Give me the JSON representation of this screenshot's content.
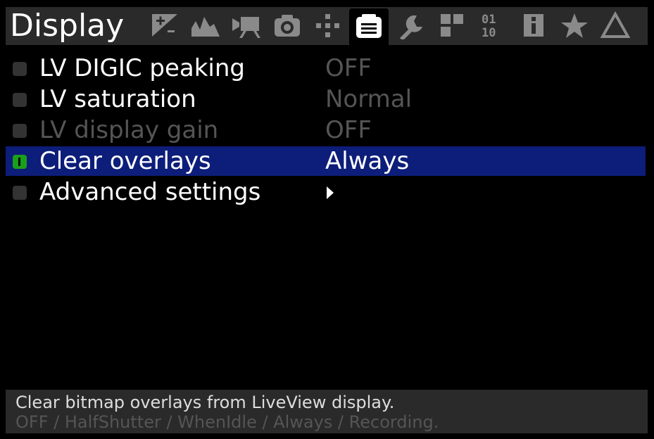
{
  "header": {
    "title": "Display",
    "tabs": [
      {
        "icon": "exposure-icon"
      },
      {
        "icon": "histogram-icon"
      },
      {
        "icon": "movie-camera-icon"
      },
      {
        "icon": "camera-icon"
      },
      {
        "icon": "focus-points-icon"
      },
      {
        "icon": "display-icon",
        "active": true
      },
      {
        "icon": "wrench-icon"
      },
      {
        "icon": "modules-icon"
      },
      {
        "icon": "binary-debug-icon"
      },
      {
        "icon": "info-icon"
      },
      {
        "icon": "star-icon"
      },
      {
        "icon": "triangle-icon"
      }
    ]
  },
  "menu": {
    "items": [
      {
        "label": "LV DIGIC peaking",
        "value": "OFF"
      },
      {
        "label": "LV saturation",
        "value": "Normal"
      },
      {
        "label": "LV display gain",
        "value": "OFF"
      },
      {
        "label": "Clear overlays",
        "value": "Always"
      },
      {
        "label": "Advanced settings",
        "value": ""
      }
    ]
  },
  "help": {
    "line1": "Clear bitmap overlays from LiveView display.",
    "line2": "OFF / HalfShutter / WhenIdle / Always / Recording."
  },
  "colors": {
    "selected_row": "#0d1d7a",
    "active_bullet": "#1aa01a",
    "header_bg": "#2a2a2a"
  }
}
